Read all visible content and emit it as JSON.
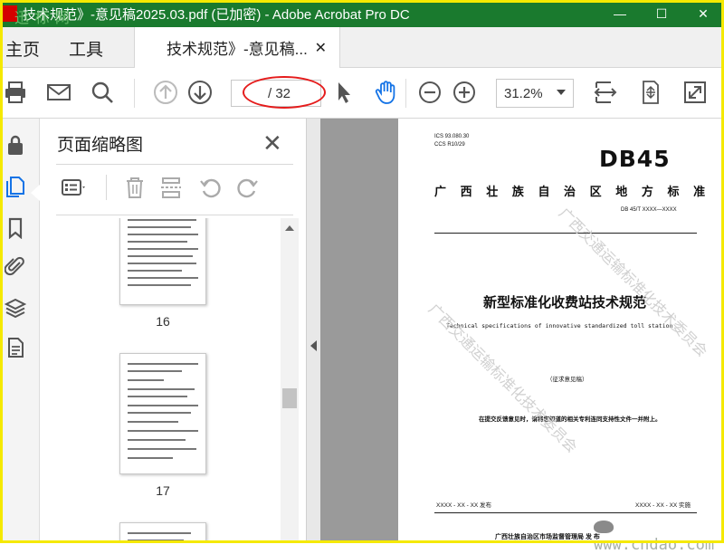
{
  "window": {
    "title": "技术规范》-意见稿2025.03.pdf  (已加密)  - Adobe Acrobat Pro DC",
    "watermark": "迅 标 网"
  },
  "tabs": {
    "home": "主页",
    "tools": "工具",
    "document": "技术规范》-意见稿..."
  },
  "toolbar": {
    "page_total": "/ 32",
    "zoom": "31.2%"
  },
  "panel": {
    "title": "页面缩略图",
    "thumbnails": [
      {
        "label": "16"
      },
      {
        "label": "17"
      }
    ]
  },
  "document_page": {
    "ics": "ICS  93.080.30",
    "ccs": "CCS R10/29",
    "logo": "DB45",
    "province_standard": "广 西 壮 族 自 治 区 地 方 标 准",
    "std_number": "DB 45/T XXXX—XXXX",
    "title_cn": "新型标准化收费站技术规范",
    "title_en": "Technical specifications of innovative standardized toll station",
    "draft": "（征求意见稿）",
    "notice": "在提交反馈意见时，请将您知道的相关专利连同支持性文件一并附上。",
    "publish_date": "XXXX - XX - XX 发布",
    "implement_date": "XXXX - XX - XX 实施",
    "issuer": "广西壮族自治区市场监督管理局    发 布",
    "watermark_text": "广西交通运输标准化技术委员会"
  },
  "site_watermark": "www.cndao.com"
}
